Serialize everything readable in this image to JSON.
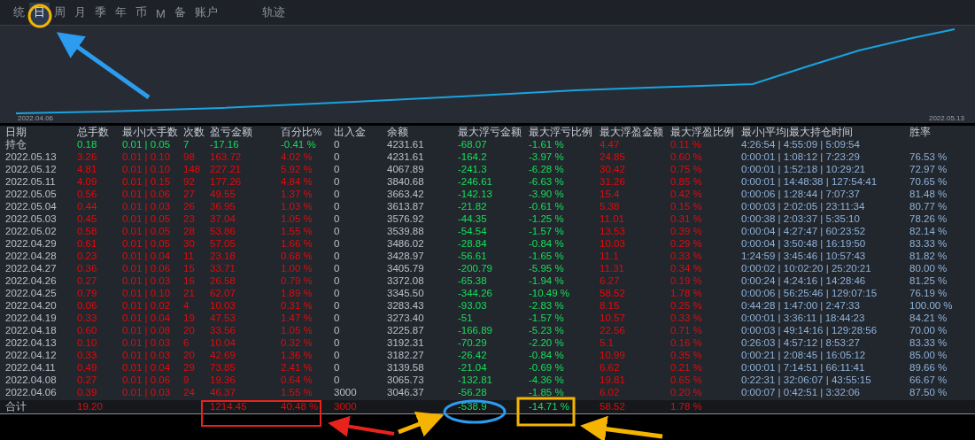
{
  "tabs": [
    {
      "label": "统",
      "selected": false
    },
    {
      "label": "日",
      "selected": true
    },
    {
      "label": "周",
      "selected": false
    },
    {
      "label": "月",
      "selected": false
    },
    {
      "label": "季",
      "selected": false
    },
    {
      "label": "年",
      "selected": false
    },
    {
      "label": "币",
      "selected": false
    },
    {
      "label": "M",
      "selected": false
    },
    {
      "label": "备",
      "selected": false
    },
    {
      "label": "账户",
      "selected": false
    },
    {
      "label": "轨迹",
      "selected": false
    }
  ],
  "equity_chart": {
    "start_label": "2022.04.06",
    "end_label": "2022.05.13"
  },
  "table": {
    "columns": [
      "日期",
      "总手数",
      "最小|大手数",
      "次数",
      "盈亏金额",
      "百分比%",
      "出入金",
      "余额",
      "最大浮亏金额",
      "最大浮亏比例",
      "最大浮盈金额",
      "最大浮盈比例",
      "最小|平均|最大持仓时间",
      "胜率"
    ],
    "rows": [
      {
        "kind": "position",
        "cells": [
          "持仓",
          "0.18",
          "0.01 | 0.05",
          "7",
          "-17.16",
          "-0.41 %",
          "0",
          "4231.61",
          "-68.07",
          "-1.61 %",
          "4.47",
          "0.11 %",
          "4:26:54 | 4:55:09 | 5:09:54",
          null
        ]
      },
      {
        "kind": "day",
        "cells": [
          "2022.05.13",
          "3.26",
          "0.01 | 0.10",
          "98",
          "163.72",
          "4.02 %",
          "0",
          "4231.61",
          "-164.2",
          "-3.97 %",
          "24.85",
          "0.60 %",
          "0:00:01 | 1:08:12 | 7:23:29",
          "76.53 %"
        ]
      },
      {
        "kind": "day",
        "cells": [
          "2022.05.12",
          "4.81",
          "0.01 | 0.10",
          "148",
          "227.21",
          "5.92 %",
          "0",
          "4067.89",
          "-241.3",
          "-6.28 %",
          "30.42",
          "0.75 %",
          "0:00:01 | 1:52:18 | 10:29:21",
          "72.97 %"
        ]
      },
      {
        "kind": "day",
        "cells": [
          "2022.05.11",
          "4.09",
          "0.01 | 0.15",
          "92",
          "177.26",
          "4.84 %",
          "0",
          "3840.68",
          "-246.61",
          "-6.63 %",
          "31.26",
          "0.85 %",
          "0:00:01 | 14:48:38 | 127:54:41",
          "70.65 %"
        ]
      },
      {
        "kind": "day",
        "cells": [
          "2022.05.05",
          "0.56",
          "0.01 | 0.06",
          "27",
          "49.55",
          "1.37 %",
          "0",
          "3663.42",
          "-142.13",
          "-3.90 %",
          "15.4",
          "0.42 %",
          "0:00:06 | 1:28:44 | 7:07:37",
          "81.48 %"
        ]
      },
      {
        "kind": "day",
        "cells": [
          "2022.05.04",
          "0.44",
          "0.01 | 0.03",
          "26",
          "36.95",
          "1.03 %",
          "0",
          "3613.87",
          "-21.82",
          "-0.61 %",
          "5.38",
          "0.15 %",
          "0:00:03 | 2:02:05 | 23:11:34",
          "80.77 %"
        ]
      },
      {
        "kind": "day",
        "cells": [
          "2022.05.03",
          "0.45",
          "0.01 | 0.05",
          "23",
          "37.04",
          "1.05 %",
          "0",
          "3576.92",
          "-44.35",
          "-1.25 %",
          "11.01",
          "0.31 %",
          "0:00:38 | 2:03:37 | 5:35:10",
          "78.26 %"
        ]
      },
      {
        "kind": "day",
        "cells": [
          "2022.05.02",
          "0.58",
          "0.01 | 0.05",
          "28",
          "53.86",
          "1.55 %",
          "0",
          "3539.88",
          "-54.54",
          "-1.57 %",
          "13.53",
          "0.39 %",
          "0:00:04 | 4:27:47 | 60:23:52",
          "82.14 %"
        ]
      },
      {
        "kind": "day",
        "cells": [
          "2022.04.29",
          "0.61",
          "0.01 | 0.05",
          "30",
          "57.05",
          "1.66 %",
          "0",
          "3486.02",
          "-28.84",
          "-0.84 %",
          "10.03",
          "0.29 %",
          "0:00:04 | 3:50:48 | 16:19:50",
          "83.33 %"
        ]
      },
      {
        "kind": "day",
        "cells": [
          "2022.04.28",
          "0.23",
          "0.01 | 0.04",
          "11",
          "23.18",
          "0.68 %",
          "0",
          "3428.97",
          "-56.61",
          "-1.65 %",
          "11.1",
          "0.33 %",
          "1:24:59 | 3:45:46 | 10:57:43",
          "81.82 %"
        ]
      },
      {
        "kind": "day",
        "cells": [
          "2022.04.27",
          "0.36",
          "0.01 | 0.06",
          "15",
          "33.71",
          "1.00 %",
          "0",
          "3405.79",
          "-200.79",
          "-5.95 %",
          "11.31",
          "0.34 %",
          "0:00:02 | 10:02:20 | 25:20:21",
          "80.00 %"
        ]
      },
      {
        "kind": "day",
        "cells": [
          "2022.04.26",
          "0.27",
          "0.01 | 0.03",
          "16",
          "26.58",
          "0.79 %",
          "0",
          "3372.08",
          "-65.38",
          "-1.94 %",
          "6.27",
          "0.19 %",
          "0:00:24 | 4:24:16 | 14:28:46",
          "81.25 %"
        ]
      },
      {
        "kind": "day",
        "cells": [
          "2022.04.25",
          "0.79",
          "0.01 | 0.10",
          "21",
          "62.07",
          "1.89 %",
          "0",
          "3345.50",
          "-344.26",
          "-10.49 %",
          "58.52",
          "1.78 %",
          "0:00:06 | 56:25:46 | 129:07:15",
          "76.19 %"
        ]
      },
      {
        "kind": "day",
        "cells": [
          "2022.04.20",
          "0.06",
          "0.01 | 0.02",
          "4",
          "10.03",
          "0.31 %",
          "0",
          "3283.43",
          "-93.03",
          "-2.83 %",
          "8.15",
          "0.25 %",
          "0:44:28 | 1:47:00 | 2:47:33",
          "100.00 %"
        ]
      },
      {
        "kind": "day",
        "cells": [
          "2022.04.19",
          "0.33",
          "0.01 | 0.04",
          "19",
          "47.53",
          "1.47 %",
          "0",
          "3273.40",
          "-51",
          "-1.57 %",
          "10.57",
          "0.33 %",
          "0:00:01 | 3:36:11 | 18:44:23",
          "84.21 %"
        ]
      },
      {
        "kind": "day",
        "cells": [
          "2022.04.18",
          "0.60",
          "0.01 | 0.08",
          "20",
          "33.56",
          "1.05 %",
          "0",
          "3225.87",
          "-166.89",
          "-5.23 %",
          "22.56",
          "0.71 %",
          "0:00:03 | 49:14:16 | 129:28:56",
          "70.00 %"
        ]
      },
      {
        "kind": "day",
        "cells": [
          "2022.04.13",
          "0.10",
          "0.01 | 0.03",
          "6",
          "10.04",
          "0.32 %",
          "0",
          "3192.31",
          "-70.29",
          "-2.20 %",
          "5.1",
          "0.16 %",
          "0:26:03 | 4:57:12 | 8:53:27",
          "83.33 %"
        ]
      },
      {
        "kind": "day",
        "cells": [
          "2022.04.12",
          "0.33",
          "0.01 | 0.03",
          "20",
          "42.69",
          "1.36 %",
          "0",
          "3182.27",
          "-26.42",
          "-0.84 %",
          "10.99",
          "0.35 %",
          "0:00:21 | 2:08:45 | 16:05:12",
          "85.00 %"
        ]
      },
      {
        "kind": "day",
        "cells": [
          "2022.04.11",
          "0.49",
          "0.01 | 0.04",
          "29",
          "73.85",
          "2.41 %",
          "0",
          "3139.58",
          "-21.04",
          "-0.69 %",
          "6.62",
          "0.21 %",
          "0:00:01 | 7:14:51 | 66:11:41",
          "89.66 %"
        ]
      },
      {
        "kind": "day",
        "cells": [
          "2022.04.08",
          "0.27",
          "0.01 | 0.06",
          "9",
          "19.36",
          "0.64 %",
          "0",
          "3065.73",
          "-132.81",
          "-4.36 %",
          "19.81",
          "0.65 %",
          "0:22:31 | 32:06:07 | 43:55:15",
          "66.67 %"
        ]
      },
      {
        "kind": "day",
        "cells": [
          "2022.04.06",
          "0.39",
          "0.01 | 0.03",
          "24",
          "46.37",
          "1.55 %",
          "3000",
          "3046.37",
          "-56.28",
          "-1.85 %",
          "6.02",
          "0.20 %",
          "0:00:07 | 0:42:51 | 3:32:06",
          "87.50 %"
        ]
      },
      {
        "kind": "total",
        "cells": [
          "合计",
          "19.20",
          null,
          null,
          "1214.45",
          "40.48 %",
          "3000",
          null,
          "-538.9",
          "-14.71 %",
          "58.52",
          "1.78 %",
          null,
          null
        ]
      }
    ]
  }
}
